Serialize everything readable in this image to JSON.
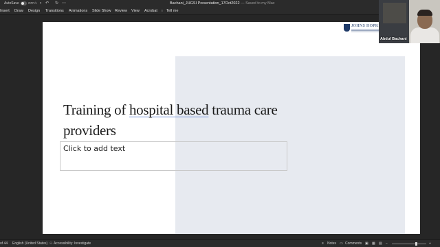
{
  "titlebar": {
    "autosave_label": "AutoSave",
    "autosave_state": "OFF",
    "document_title": "Bachani_JHGSI Presentation_17Oct2022",
    "document_status": " — Saved to my Mac",
    "quick_access_icons": [
      "home-icon",
      "save-icon",
      "undo-icon",
      "redo-icon",
      "more-icon"
    ]
  },
  "ribbon": {
    "tabs": [
      "Insert",
      "Draw",
      "Design",
      "Transitions",
      "Animations",
      "Slide Show",
      "Review",
      "View",
      "Acrobat",
      "Tell me"
    ]
  },
  "slide": {
    "title_part1": "Training of ",
    "title_underlined": "hospital based",
    "title_part2": " trauma care providers",
    "placeholder": "Click to add text",
    "logo_text": "JOHNS HOPKINS",
    "panel_color": "#e7eaf0"
  },
  "video": {
    "participant_name": "Abdul Bachani"
  },
  "statusbar": {
    "slide_counter": "of 44",
    "language": "English (United States)",
    "accessibility": "Accessibility: Investigate",
    "notes": "Notes",
    "comments": "Comments"
  }
}
